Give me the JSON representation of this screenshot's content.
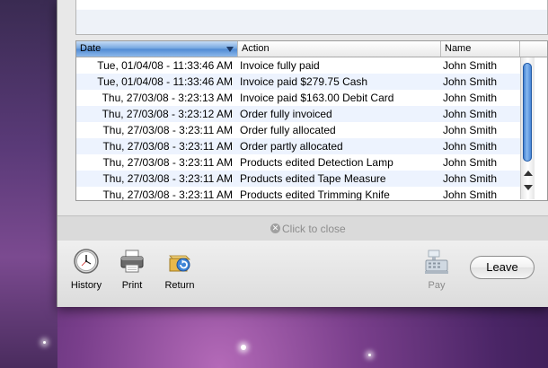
{
  "table": {
    "columns": [
      "Date",
      "Action",
      "Name"
    ],
    "rows": [
      {
        "date": "Tue, 01/04/08 - 11:33:46 AM",
        "action": "Invoice fully paid",
        "name": "John Smith"
      },
      {
        "date": "Tue, 01/04/08 - 11:33:46 AM",
        "action": "Invoice paid $279.75 Cash",
        "name": "John Smith"
      },
      {
        "date": "Thu, 27/03/08 - 3:23:13 AM",
        "action": "Invoice paid $163.00 Debit Card",
        "name": "John Smith"
      },
      {
        "date": "Thu, 27/03/08 - 3:23:12 AM",
        "action": "Order fully invoiced",
        "name": "John Smith"
      },
      {
        "date": "Thu, 27/03/08 - 3:23:11 AM",
        "action": "Order fully allocated",
        "name": "John Smith"
      },
      {
        "date": "Thu, 27/03/08 - 3:23:11 AM",
        "action": "Order partly allocated",
        "name": "John Smith"
      },
      {
        "date": "Thu, 27/03/08 - 3:23:11 AM",
        "action": "Products edited Detection Lamp",
        "name": "John Smith"
      },
      {
        "date": "Thu, 27/03/08 - 3:23:11 AM",
        "action": "Products edited Tape Measure",
        "name": "John Smith"
      },
      {
        "date": "Thu, 27/03/08 - 3:23:11 AM",
        "action": "Products edited Trimming Knife",
        "name": "John Smith"
      }
    ]
  },
  "close_bar": {
    "label": "Click to close"
  },
  "toolbar": {
    "history_label": "History",
    "print_label": "Print",
    "return_label": "Return",
    "pay_label": "Pay",
    "leave_label": "Leave"
  },
  "icons": {
    "history": "clock-icon",
    "print": "printer-icon",
    "return": "return-box-icon",
    "pay": "cash-register-icon",
    "close": "close-circle-icon"
  },
  "colors": {
    "header_selected": "#4f8ad4",
    "row_alt": "#edf3fe",
    "scroll_thumb": "#3a7bd1"
  }
}
